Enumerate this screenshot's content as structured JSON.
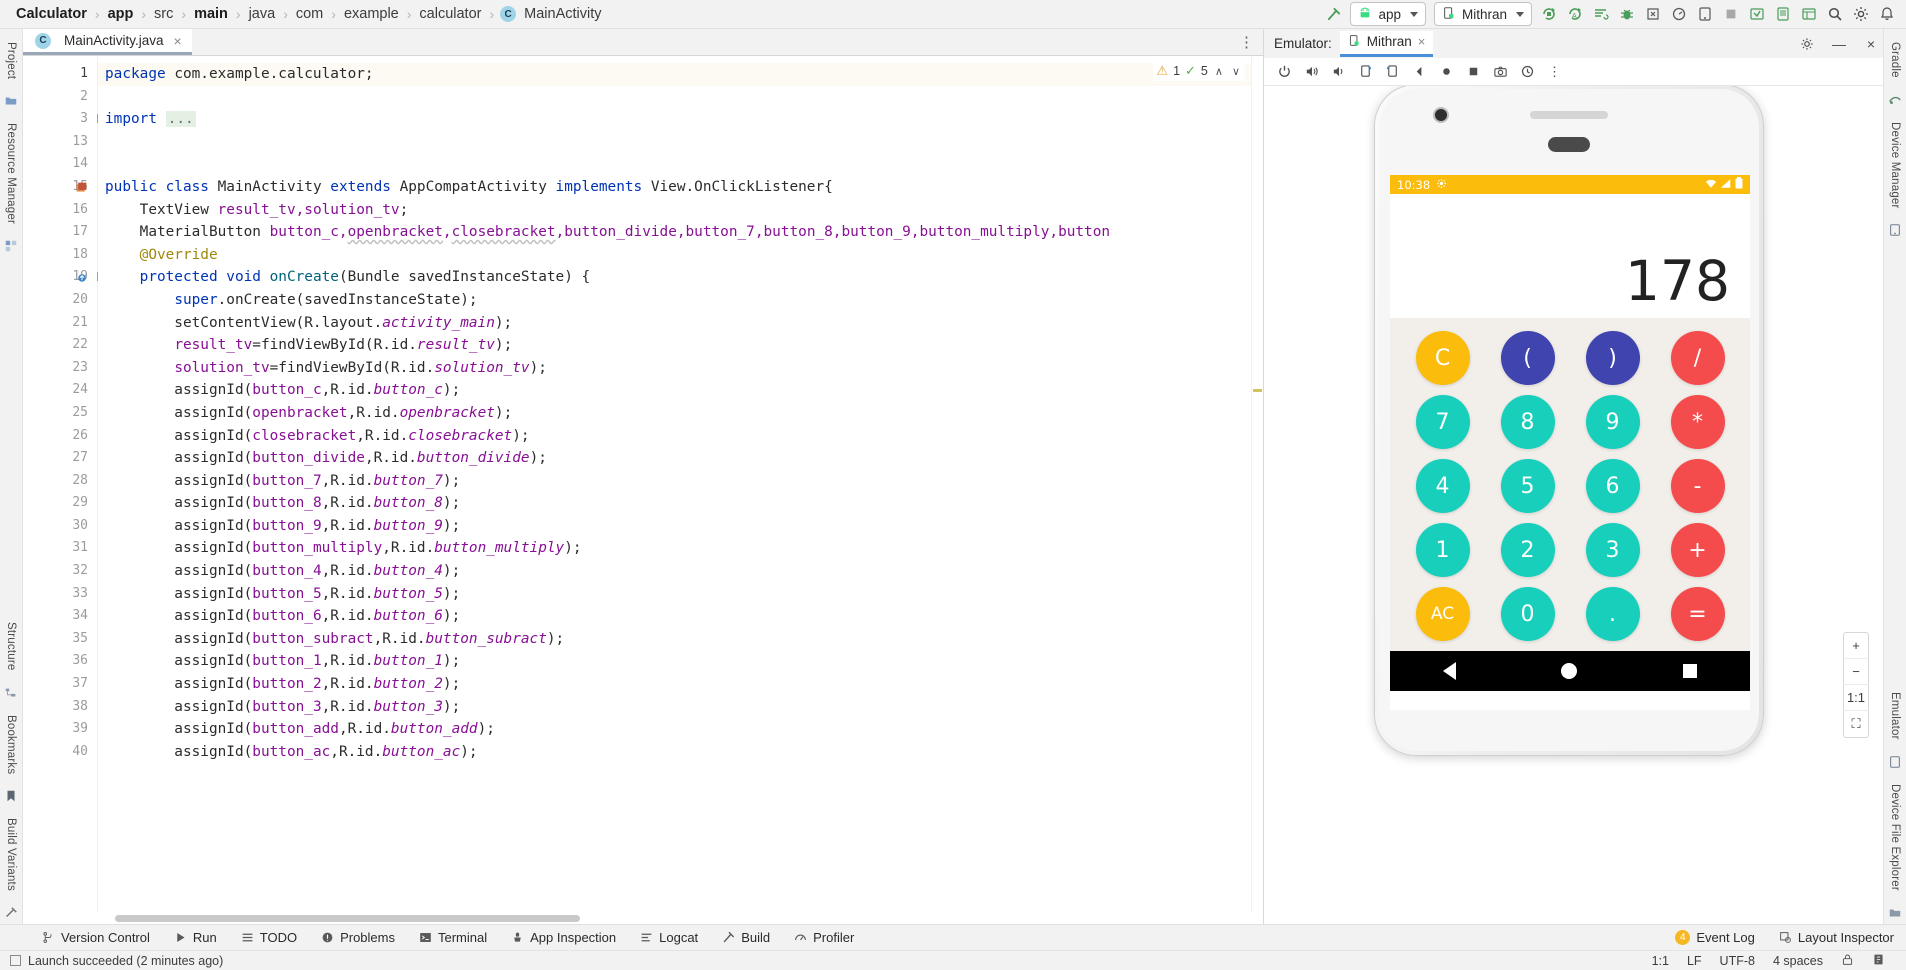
{
  "breadcrumb": {
    "items": [
      {
        "label": "Calculator",
        "bold": true
      },
      {
        "label": "app",
        "bold": true
      },
      {
        "label": "src",
        "bold": false
      },
      {
        "label": "main",
        "bold": true
      },
      {
        "label": "java",
        "bold": false
      },
      {
        "label": "com",
        "bold": false
      },
      {
        "label": "example",
        "bold": false
      },
      {
        "label": "calculator",
        "bold": false
      },
      {
        "label": "MainActivity",
        "bold": false,
        "icon": "C"
      }
    ],
    "separator": "›"
  },
  "toolbar": {
    "build_icon": "build-hammer-icon",
    "module_chip": {
      "label": "app",
      "icon": "android-icon"
    },
    "device_chip": {
      "label": "Mithran",
      "icon": "device-phone-icon"
    },
    "icons": [
      "run-icon",
      "debug-run-icon",
      "apply-changes-icon",
      "debug-bug-icon",
      "profile-icon",
      "device-manager-icon",
      "stop-icon",
      "layout-icon",
      "sdk-icon",
      "avd-icon",
      "search-icon",
      "settings-gear-icon",
      "notifications-icon"
    ]
  },
  "left_rail": {
    "tabs": [
      "Project",
      "Resource Manager"
    ],
    "bottom_tabs": [
      "Structure",
      "Bookmarks",
      "Build Variants"
    ]
  },
  "right_rail": {
    "tabs": [
      "Gradle",
      "Device Manager"
    ],
    "bottom_tabs": [
      "Emulator",
      "Device File Explorer"
    ]
  },
  "editor": {
    "tab": {
      "label": "MainActivity.java",
      "icon": "C",
      "close": "×"
    },
    "overflow_icon": "⋮",
    "inspection": {
      "warnings": "1",
      "weak_warnings": "5",
      "warn_icon": "warning-triangle-icon",
      "ok_icon": "inspection-eye-icon",
      "up_icon": "∧",
      "down_icon": "∨"
    },
    "lines": [
      {
        "n": "1",
        "current": true,
        "tokens": [
          {
            "t": "package ",
            "c": "kw"
          },
          {
            "t": "com.example.calculator;",
            "c": ""
          }
        ]
      },
      {
        "n": "2",
        "tokens": []
      },
      {
        "n": "3",
        "fold": "+",
        "tokens": [
          {
            "t": "import ",
            "c": "kw"
          },
          {
            "t": "...",
            "c": "fold-chip"
          }
        ]
      },
      {
        "n": "13",
        "tokens": []
      },
      {
        "n": "14",
        "tokens": []
      },
      {
        "n": "15",
        "gmark": "class-icon",
        "tokens": [
          {
            "t": "public class ",
            "c": "kw"
          },
          {
            "t": "MainActivity ",
            "c": ""
          },
          {
            "t": "extends ",
            "c": "kw"
          },
          {
            "t": "AppCompatActivity ",
            "c": ""
          },
          {
            "t": "implements ",
            "c": "kw"
          },
          {
            "t": "View.OnClickListener{",
            "c": ""
          }
        ]
      },
      {
        "n": "16",
        "tokens": [
          {
            "t": "    TextView ",
            "c": ""
          },
          {
            "t": "result_tv,solution_tv",
            "c": "fld"
          },
          {
            "t": ";",
            "c": ""
          }
        ]
      },
      {
        "n": "17",
        "tokens": [
          {
            "t": "    MaterialButton ",
            "c": ""
          },
          {
            "t": "button_c,",
            "c": "fld"
          },
          {
            "t": "openbracket",
            "c": "fld wavy"
          },
          {
            "t": ",",
            "c": "fld"
          },
          {
            "t": "closebracket",
            "c": "fld wavy"
          },
          {
            "t": ",button_divide,button_7,button_8,button_9,button_multiply,button",
            "c": "fld"
          }
        ]
      },
      {
        "n": "18",
        "tokens": [
          {
            "t": "    @Override",
            "c": "ann"
          }
        ]
      },
      {
        "n": "19",
        "gmark": "override-icon",
        "fold": "-",
        "tokens": [
          {
            "t": "    protected void ",
            "c": "kw"
          },
          {
            "t": "onCreate",
            "c": "mth"
          },
          {
            "t": "(Bundle savedInstanceState) {",
            "c": ""
          }
        ]
      },
      {
        "n": "20",
        "tokens": [
          {
            "t": "        ",
            "c": ""
          },
          {
            "t": "super",
            "c": "kw"
          },
          {
            "t": ".onCreate(savedInstanceState);",
            "c": ""
          }
        ]
      },
      {
        "n": "21",
        "tokens": [
          {
            "t": "        setContentView(R.layout.",
            "c": ""
          },
          {
            "t": "activity_main",
            "c": "fldi"
          },
          {
            "t": ");",
            "c": ""
          }
        ]
      },
      {
        "n": "22",
        "tokens": [
          {
            "t": "        ",
            "c": ""
          },
          {
            "t": "result_tv",
            "c": "fld"
          },
          {
            "t": "=findViewById(R.id.",
            "c": ""
          },
          {
            "t": "result_tv",
            "c": "fldi"
          },
          {
            "t": ");",
            "c": ""
          }
        ]
      },
      {
        "n": "23",
        "tokens": [
          {
            "t": "        ",
            "c": ""
          },
          {
            "t": "solution_tv",
            "c": "fld"
          },
          {
            "t": "=findViewById(R.id.",
            "c": ""
          },
          {
            "t": "solution_tv",
            "c": "fldi"
          },
          {
            "t": ");",
            "c": ""
          }
        ]
      },
      {
        "n": "24",
        "tokens": [
          {
            "t": "        assignId(",
            "c": ""
          },
          {
            "t": "button_c",
            "c": "fld"
          },
          {
            "t": ",R.id.",
            "c": ""
          },
          {
            "t": "button_c",
            "c": "fldi"
          },
          {
            "t": ");",
            "c": ""
          }
        ]
      },
      {
        "n": "25",
        "tokens": [
          {
            "t": "        assignId(",
            "c": ""
          },
          {
            "t": "openbracket",
            "c": "fld"
          },
          {
            "t": ",R.id.",
            "c": ""
          },
          {
            "t": "openbracket",
            "c": "fldi"
          },
          {
            "t": ");",
            "c": ""
          }
        ]
      },
      {
        "n": "26",
        "tokens": [
          {
            "t": "        assignId(",
            "c": ""
          },
          {
            "t": "closebracket",
            "c": "fld"
          },
          {
            "t": ",R.id.",
            "c": ""
          },
          {
            "t": "closebracket",
            "c": "fldi"
          },
          {
            "t": ");",
            "c": ""
          }
        ]
      },
      {
        "n": "27",
        "tokens": [
          {
            "t": "        assignId(",
            "c": ""
          },
          {
            "t": "button_divide",
            "c": "fld"
          },
          {
            "t": ",R.id.",
            "c": ""
          },
          {
            "t": "button_divide",
            "c": "fldi"
          },
          {
            "t": ");",
            "c": ""
          }
        ]
      },
      {
        "n": "28",
        "tokens": [
          {
            "t": "        assignId(",
            "c": ""
          },
          {
            "t": "button_7",
            "c": "fld"
          },
          {
            "t": ",R.id.",
            "c": ""
          },
          {
            "t": "button_7",
            "c": "fldi"
          },
          {
            "t": ");",
            "c": ""
          }
        ]
      },
      {
        "n": "29",
        "tokens": [
          {
            "t": "        assignId(",
            "c": ""
          },
          {
            "t": "button_8",
            "c": "fld"
          },
          {
            "t": ",R.id.",
            "c": ""
          },
          {
            "t": "button_8",
            "c": "fldi"
          },
          {
            "t": ");",
            "c": ""
          }
        ]
      },
      {
        "n": "30",
        "tokens": [
          {
            "t": "        assignId(",
            "c": ""
          },
          {
            "t": "button_9",
            "c": "fld"
          },
          {
            "t": ",R.id.",
            "c": ""
          },
          {
            "t": "button_9",
            "c": "fldi"
          },
          {
            "t": ");",
            "c": ""
          }
        ]
      },
      {
        "n": "31",
        "tokens": [
          {
            "t": "        assignId(",
            "c": ""
          },
          {
            "t": "button_multiply",
            "c": "fld"
          },
          {
            "t": ",R.id.",
            "c": ""
          },
          {
            "t": "button_multiply",
            "c": "fldi"
          },
          {
            "t": ");",
            "c": ""
          }
        ]
      },
      {
        "n": "32",
        "tokens": [
          {
            "t": "        assignId(",
            "c": ""
          },
          {
            "t": "button_4",
            "c": "fld"
          },
          {
            "t": ",R.id.",
            "c": ""
          },
          {
            "t": "button_4",
            "c": "fldi"
          },
          {
            "t": ");",
            "c": ""
          }
        ]
      },
      {
        "n": "33",
        "tokens": [
          {
            "t": "        assignId(",
            "c": ""
          },
          {
            "t": "button_5",
            "c": "fld"
          },
          {
            "t": ",R.id.",
            "c": ""
          },
          {
            "t": "button_5",
            "c": "fldi"
          },
          {
            "t": ");",
            "c": ""
          }
        ]
      },
      {
        "n": "34",
        "tokens": [
          {
            "t": "        assignId(",
            "c": ""
          },
          {
            "t": "button_6",
            "c": "fld"
          },
          {
            "t": ",R.id.",
            "c": ""
          },
          {
            "t": "button_6",
            "c": "fldi"
          },
          {
            "t": ");",
            "c": ""
          }
        ]
      },
      {
        "n": "35",
        "tokens": [
          {
            "t": "        assignId(",
            "c": ""
          },
          {
            "t": "button_subract",
            "c": "fld"
          },
          {
            "t": ",R.id.",
            "c": ""
          },
          {
            "t": "button_subract",
            "c": "fldi"
          },
          {
            "t": ");",
            "c": ""
          }
        ]
      },
      {
        "n": "36",
        "tokens": [
          {
            "t": "        assignId(",
            "c": ""
          },
          {
            "t": "button_1",
            "c": "fld"
          },
          {
            "t": ",R.id.",
            "c": ""
          },
          {
            "t": "button_1",
            "c": "fldi"
          },
          {
            "t": ");",
            "c": ""
          }
        ]
      },
      {
        "n": "37",
        "tokens": [
          {
            "t": "        assignId(",
            "c": ""
          },
          {
            "t": "button_2",
            "c": "fld"
          },
          {
            "t": ",R.id.",
            "c": ""
          },
          {
            "t": "button_2",
            "c": "fldi"
          },
          {
            "t": ");",
            "c": ""
          }
        ]
      },
      {
        "n": "38",
        "tokens": [
          {
            "t": "        assignId(",
            "c": ""
          },
          {
            "t": "button_3",
            "c": "fld"
          },
          {
            "t": ",R.id.",
            "c": ""
          },
          {
            "t": "button_3",
            "c": "fldi"
          },
          {
            "t": ");",
            "c": ""
          }
        ]
      },
      {
        "n": "39",
        "tokens": [
          {
            "t": "        assignId(",
            "c": ""
          },
          {
            "t": "button_add",
            "c": "fld"
          },
          {
            "t": ",R.id.",
            "c": ""
          },
          {
            "t": "button_add",
            "c": "fldi"
          },
          {
            "t": ");",
            "c": ""
          }
        ]
      },
      {
        "n": "40",
        "tokens": [
          {
            "t": "        assignId(",
            "c": ""
          },
          {
            "t": "button_ac",
            "c": "fld"
          },
          {
            "t": ",R.id.",
            "c": ""
          },
          {
            "t": "button_ac",
            "c": "fldi"
          },
          {
            "t": ");",
            "c": ""
          }
        ]
      }
    ]
  },
  "emulator": {
    "title": "Emulator:",
    "tab_label": "Mithran",
    "tab_close": "×",
    "settings_icon": "settings-gear-icon",
    "minimize_icon": "—",
    "close_icon": "×",
    "toolbar_icons": [
      "power-icon",
      "volume-up-icon",
      "volume-down-icon",
      "rotate-left-icon",
      "rotate-right-icon",
      "back-icon",
      "home-icon",
      "overview-icon",
      "screenshot-camera-icon",
      "history-icon",
      "more-menu-icon"
    ],
    "float_controls": [
      "+",
      "−",
      "1:1",
      "⛶"
    ],
    "device": {
      "status_time": "10:38",
      "status_icon": "settings-gear-icon",
      "status_right": [
        "wifi-icon",
        "signal-icon",
        "battery-icon"
      ],
      "display": {
        "solution": "",
        "result": "178"
      },
      "keys": [
        {
          "label": "C",
          "color": "#FBBC0B",
          "name": "key-clear"
        },
        {
          "label": "(",
          "color": "#3F44AE",
          "name": "key-open-bracket"
        },
        {
          "label": ")",
          "color": "#3F44AE",
          "name": "key-close-bracket"
        },
        {
          "label": "/",
          "color": "#F44C4C",
          "name": "key-divide"
        },
        {
          "label": "7",
          "color": "#17CFBB",
          "name": "key-7"
        },
        {
          "label": "8",
          "color": "#17CFBB",
          "name": "key-8"
        },
        {
          "label": "9",
          "color": "#17CFBB",
          "name": "key-9"
        },
        {
          "label": "*",
          "color": "#F44C4C",
          "name": "key-multiply"
        },
        {
          "label": "4",
          "color": "#17CFBB",
          "name": "key-4"
        },
        {
          "label": "5",
          "color": "#17CFBB",
          "name": "key-5"
        },
        {
          "label": "6",
          "color": "#17CFBB",
          "name": "key-6"
        },
        {
          "label": "-",
          "color": "#F44C4C",
          "name": "key-subtract"
        },
        {
          "label": "1",
          "color": "#17CFBB",
          "name": "key-1"
        },
        {
          "label": "2",
          "color": "#17CFBB",
          "name": "key-2"
        },
        {
          "label": "3",
          "color": "#17CFBB",
          "name": "key-3"
        },
        {
          "label": "+",
          "color": "#F44C4C",
          "name": "key-add"
        },
        {
          "label": "AC",
          "color": "#FBBC0B",
          "name": "key-all-clear",
          "small": true
        },
        {
          "label": "0",
          "color": "#17CFBB",
          "name": "key-0"
        },
        {
          "label": ".",
          "color": "#17CFBB",
          "name": "key-decimal"
        },
        {
          "label": "=",
          "color": "#F44C4C",
          "name": "key-equals"
        }
      ],
      "navbar": [
        "back-triangle-icon",
        "home-circle-icon",
        "recents-square-icon"
      ]
    }
  },
  "bottom_tools": {
    "items": [
      {
        "label": "Version Control",
        "icon": "branch-icon"
      },
      {
        "label": "Run",
        "icon": "play-icon"
      },
      {
        "label": "TODO",
        "icon": "list-icon"
      },
      {
        "label": "Problems",
        "icon": "error-icon"
      },
      {
        "label": "Terminal",
        "icon": "terminal-icon"
      },
      {
        "label": "App Inspection",
        "icon": "inspection-icon"
      },
      {
        "label": "Logcat",
        "icon": "logcat-icon"
      },
      {
        "label": "Build",
        "icon": "hammer-icon"
      },
      {
        "label": "Profiler",
        "icon": "profiler-icon"
      }
    ],
    "right": [
      {
        "label": "Event Log",
        "badge": "4",
        "icon": "event-log-icon"
      },
      {
        "label": "Layout Inspector",
        "icon": "layout-inspector-icon"
      }
    ]
  },
  "status": {
    "message": "Launch succeeded (2 minutes ago)",
    "message_icon": "notification-icon",
    "caret": "1:1",
    "line_sep": "LF",
    "encoding": "UTF-8",
    "indent": "4 spaces",
    "lock_icon": "lock-icon",
    "inspect_icon": "inspector-icon"
  },
  "theme": {
    "accent_blue": "#4a90d9",
    "keyword": "#0033b3",
    "field": "#871094",
    "method": "#00627a",
    "annotation": "#9e880d",
    "status_orange": "#FBBC0B"
  }
}
